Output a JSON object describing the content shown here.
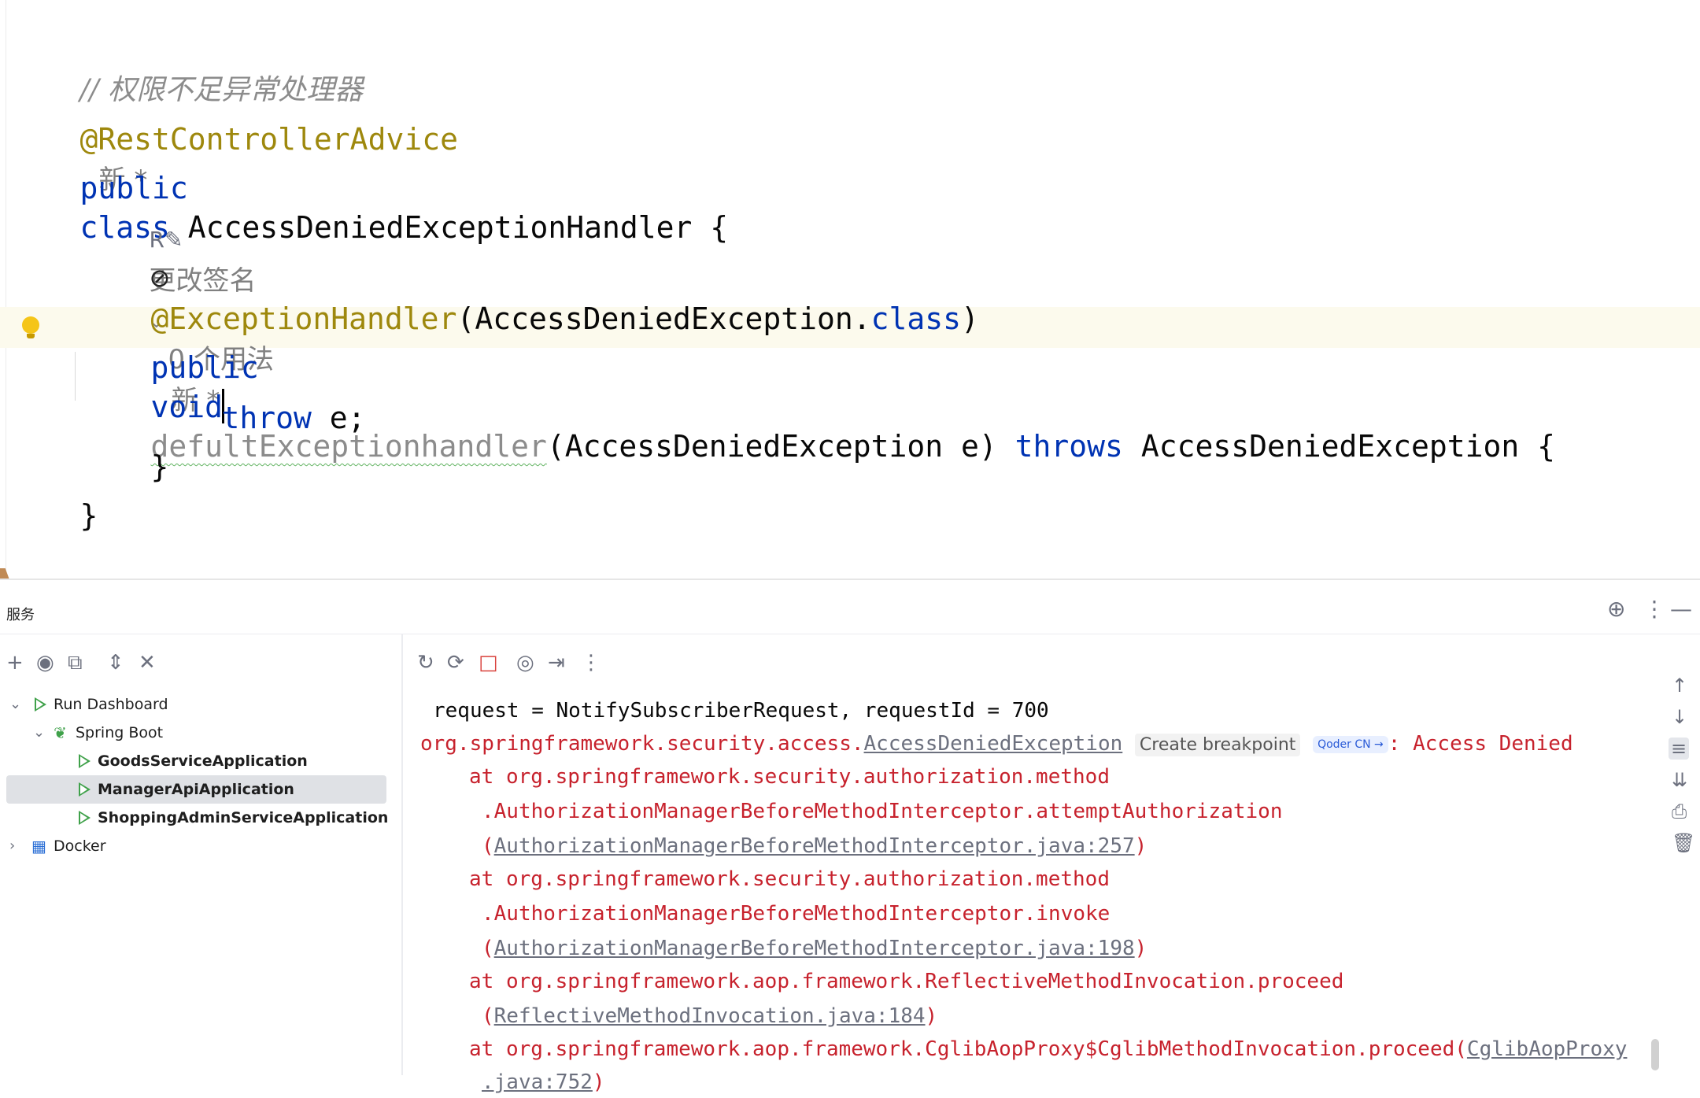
{
  "editor": {
    "comment": "// 权限不足异常处理器",
    "annotation_class": "@RestControllerAdvice",
    "new_badge": "新 *",
    "class_kw1": "public",
    "class_kw2": "class",
    "class_decl": " AccessDeniedExceptionHandler {",
    "change_signature": "更改签名",
    "method_annotation": "@ExceptionHandler",
    "method_annotation_args": "(AccessDeniedException.",
    "method_annotation_class_kw": "class",
    "method_annotation_close": ")",
    "usages_hint": "0 个用法",
    "new_badge2": "新 *",
    "method_public": "public",
    "method_void": "void",
    "method_name": "defultExceptionhandler",
    "method_params": "(AccessDeniedException e) ",
    "method_throws": "throws",
    "method_rest": " AccessDeniedException {",
    "throw_kw": "throw",
    "throw_rest": " e;",
    "close_inner": "}",
    "close_outer": "}"
  },
  "toolwindow": {
    "title": "服务",
    "tree": [
      {
        "label": "Run Dashboard"
      },
      {
        "label": "Spring Boot"
      },
      {
        "label": "GoodsServiceApplication"
      },
      {
        "label": "ManagerApiApplication"
      },
      {
        "label": "ShoppingAdminServiceApplication"
      },
      {
        "label": "Docker"
      }
    ]
  },
  "console": {
    "line1": "request = NotifySubscriberRequest, requestId = 700",
    "line2_pkg": "org.springframework.security.access.",
    "line2_link": "AccessDeniedException",
    "create_breakpoint": "Create breakpoint",
    "qoder": "Qoder CN →",
    "line2_tail": ": Access Denied",
    "l3": "at org.springframework.security.authorization.method",
    "l4": ".AuthorizationManagerBeforeMethodInterceptor.attemptAuthorization",
    "l5_link": "AuthorizationManagerBeforeMethodInterceptor.java:257",
    "l6": "at org.springframework.security.authorization.method",
    "l7": ".AuthorizationManagerBeforeMethodInterceptor.invoke",
    "l8_link": "AuthorizationManagerBeforeMethodInterceptor.java:198",
    "l9": "at org.springframework.aop.framework.ReflectiveMethodInvocation.proceed",
    "l10_link": "ReflectiveMethodInvocation.java:184",
    "l11": "at org.springframework.aop.framework.CglibAopProxy$CglibMethodInvocation.proceed(",
    "l11_link": "CglibAopProxy",
    "l12_link": ".java:752",
    "paren_open": "(",
    "paren_close": ")"
  },
  "icons": {
    "run": "run-icon",
    "spring": "spring-boot-icon",
    "docker": "docker-icon",
    "bulb": "lightbulb-icon"
  }
}
